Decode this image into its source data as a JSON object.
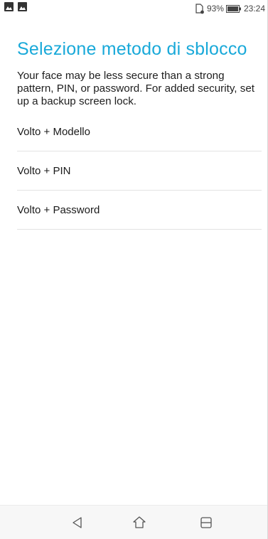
{
  "status_bar": {
    "battery_percent": "93%",
    "battery_level": 0.93,
    "time": "23:24",
    "icons": [
      "image-notification-icon",
      "image-notification-icon",
      "sim-card-icon",
      "battery-icon"
    ]
  },
  "header": {
    "title": "Selezione metodo di sblocco"
  },
  "description": "Your face may be less secure than a strong pattern, PIN, or password. For added security, set up a backup screen lock.",
  "options": [
    {
      "label": "Volto + Modello"
    },
    {
      "label": "Volto + PIN"
    },
    {
      "label": "Volto + Password"
    }
  ],
  "nav_bar": {
    "icons": [
      "back-icon",
      "home-icon",
      "recents-icon"
    ]
  },
  "colors": {
    "title": "#19a9d9",
    "divider": "#e3e3e3",
    "nav_background": "#f7f7f7"
  }
}
